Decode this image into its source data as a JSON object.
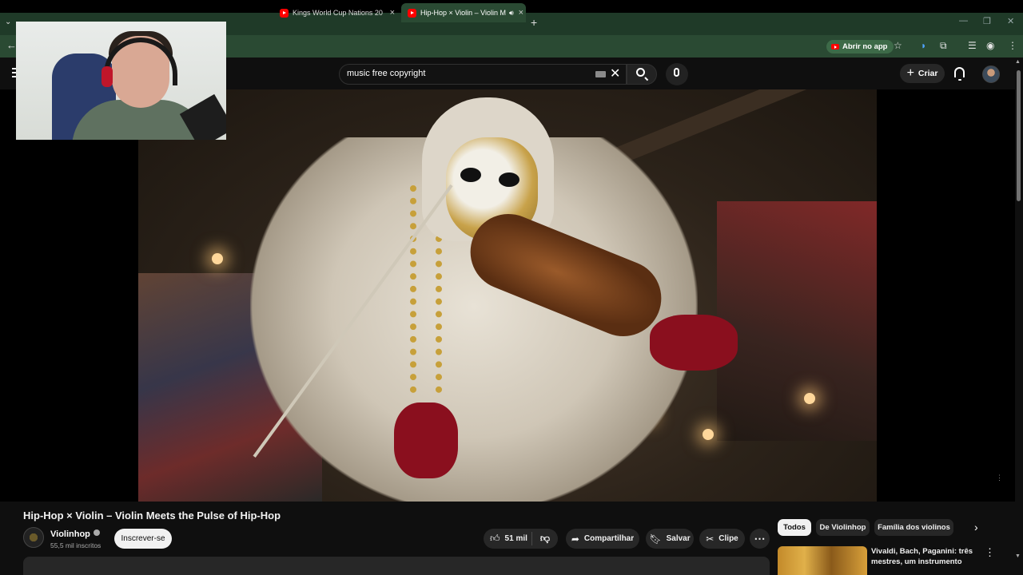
{
  "browser": {
    "tabs": [
      {
        "label": "Kings World Cup Nations 20",
        "active": false
      },
      {
        "label": "Hip-Hop × Violin – Violin M",
        "active": true
      }
    ],
    "open_app_label": "Abrir no app"
  },
  "youtube": {
    "search": {
      "value": "music free copyright"
    },
    "create_label": "Criar"
  },
  "video": {
    "title": "Hip-Hop × Violin – Violin Meets the Pulse of Hip-Hop",
    "channel": {
      "name": "Violinhop",
      "subscribers": "55,5 mil inscritos"
    },
    "subscribe_label": "Inscrever-se",
    "likes": "51 mil",
    "share_label": "Compartilhar",
    "save_label": "Salvar",
    "clip_label": "Clipe"
  },
  "sidebar": {
    "chips": [
      "Todos",
      "De Violinhop",
      "Família dos violinos"
    ],
    "recommendation": {
      "title": "Vivaldi, Bach, Paganini: três mestres, um instrumento"
    }
  },
  "colors": {
    "brand_red": "#ff0000",
    "tab_strip": "#1f3a28",
    "background": "#0f0f0f"
  }
}
